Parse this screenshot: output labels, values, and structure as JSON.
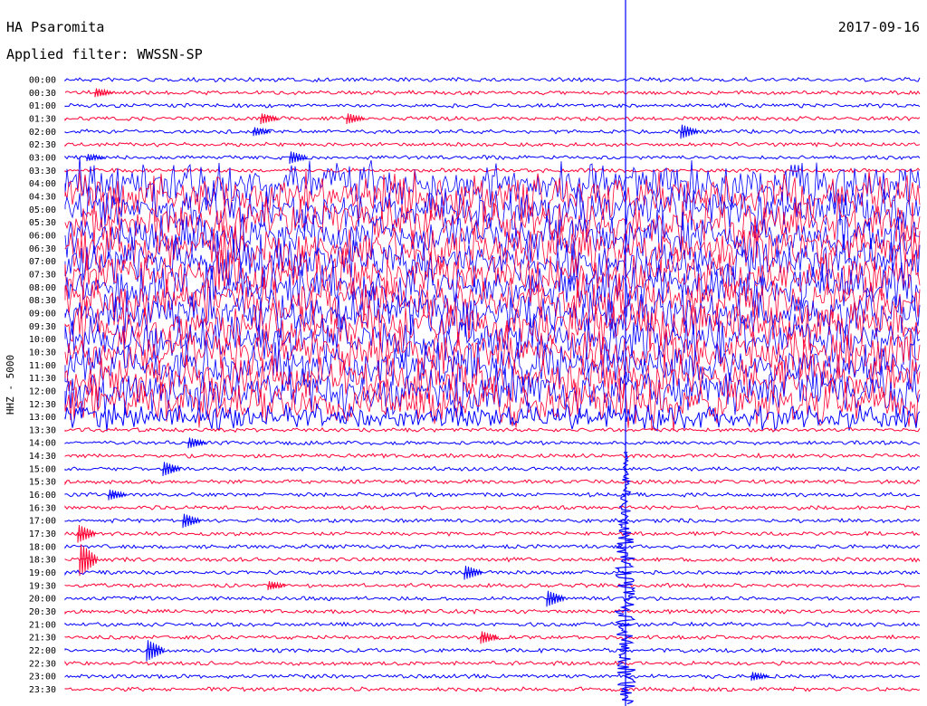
{
  "header": {
    "station": "HA Psaromita",
    "date": "2017-09-16",
    "filter": "Applied filter: WWSSN-SP"
  },
  "chart_data": {
    "type": "line",
    "title": "HA Psaromita",
    "date": "2017-09-16",
    "ylabel": "HHZ - 5000",
    "time_labels": [
      "00:00",
      "00:30",
      "01:00",
      "01:30",
      "02:00",
      "02:30",
      "03:00",
      "03:30",
      "04:00",
      "04:30",
      "05:00",
      "05:30",
      "06:00",
      "06:30",
      "07:00",
      "07:30",
      "08:00",
      "08:30",
      "09:00",
      "09:30",
      "10:00",
      "10:30",
      "11:00",
      "11:30",
      "12:00",
      "12:30",
      "13:00",
      "13:30",
      "14:00",
      "14:30",
      "15:00",
      "15:30",
      "16:00",
      "16:30",
      "17:00",
      "17:30",
      "18:00",
      "18:30",
      "19:00",
      "19:30",
      "20:00",
      "20:30",
      "21:00",
      "21:30",
      "22:00",
      "22:30",
      "23:00",
      "23:30"
    ],
    "series_colors": [
      "#0000ff",
      "#ff0033"
    ],
    "marker_color": "#0000ff",
    "grid": false
  }
}
